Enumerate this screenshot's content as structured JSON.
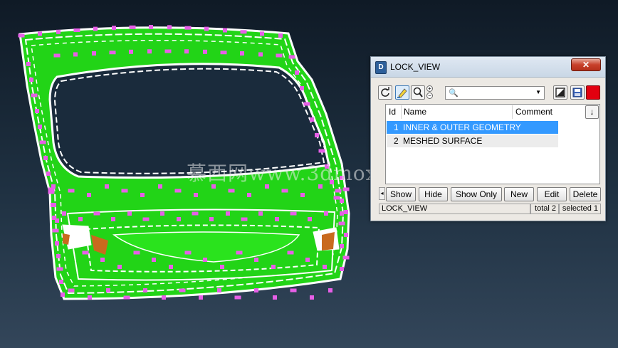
{
  "watermark": "慕西网www.3dmox.com",
  "colors": {
    "background_top": "#0f1a26",
    "background_bottom": "#33465a",
    "surface_green": "#22d417",
    "trim_lines": "#ffffff",
    "weld_points": "#e75fe7",
    "reinforcement_orange": "#c96a1e",
    "selection": "#3399ff",
    "color_swatch": "#e2000f"
  },
  "dialog": {
    "title": "LOCK_VIEW",
    "close_icon": "close-icon",
    "toolbar": {
      "icons": [
        "refresh-icon",
        "highlighter-icon",
        "zoom-icon",
        "zoom-steps-icon",
        "search-icon",
        "display-icon",
        "save-icon",
        "color-icon"
      ],
      "search_value": ""
    },
    "columns": {
      "id": "Id",
      "name": "Name",
      "comment": "Comment"
    },
    "rows": [
      {
        "id": "1",
        "name": "INNER & OUTER GEOMETRY",
        "selected": true
      },
      {
        "id": "2",
        "name": "MESHED SURFACE",
        "selected": false
      }
    ],
    "buttons": {
      "show": "Show",
      "hide": "Hide",
      "show_only": "Show Only",
      "new": "New",
      "edit": "Edit",
      "delete": "Delete"
    },
    "status": {
      "name": "LOCK_VIEW",
      "total": "total 2",
      "selected": "selected 1"
    }
  }
}
